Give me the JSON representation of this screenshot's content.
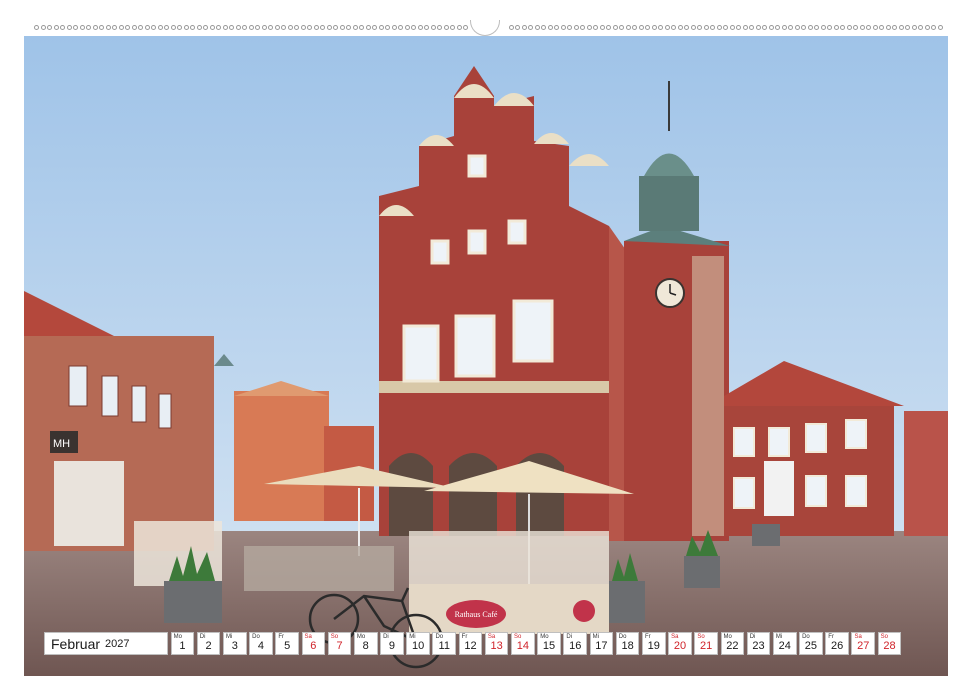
{
  "calendar": {
    "month": "Februar",
    "year": "2027",
    "days": [
      {
        "wd": "Mo",
        "num": "1",
        "red": false
      },
      {
        "wd": "Di",
        "num": "2",
        "red": false
      },
      {
        "wd": "Mi",
        "num": "3",
        "red": false
      },
      {
        "wd": "Do",
        "num": "4",
        "red": false
      },
      {
        "wd": "Fr",
        "num": "5",
        "red": false
      },
      {
        "wd": "Sa",
        "num": "6",
        "red": true
      },
      {
        "wd": "So",
        "num": "7",
        "red": true
      },
      {
        "wd": "Mo",
        "num": "8",
        "red": false
      },
      {
        "wd": "Di",
        "num": "9",
        "red": false
      },
      {
        "wd": "Mi",
        "num": "10",
        "red": false
      },
      {
        "wd": "Do",
        "num": "11",
        "red": false
      },
      {
        "wd": "Fr",
        "num": "12",
        "red": false
      },
      {
        "wd": "Sa",
        "num": "13",
        "red": true
      },
      {
        "wd": "So",
        "num": "14",
        "red": true
      },
      {
        "wd": "Mo",
        "num": "15",
        "red": false
      },
      {
        "wd": "Di",
        "num": "16",
        "red": false
      },
      {
        "wd": "Mi",
        "num": "17",
        "red": false
      },
      {
        "wd": "Do",
        "num": "18",
        "red": false
      },
      {
        "wd": "Fr",
        "num": "19",
        "red": false
      },
      {
        "wd": "Sa",
        "num": "20",
        "red": true
      },
      {
        "wd": "So",
        "num": "21",
        "red": true
      },
      {
        "wd": "Mo",
        "num": "22",
        "red": false
      },
      {
        "wd": "Di",
        "num": "23",
        "red": false
      },
      {
        "wd": "Mi",
        "num": "24",
        "red": false
      },
      {
        "wd": "Do",
        "num": "25",
        "red": false
      },
      {
        "wd": "Fr",
        "num": "26",
        "red": false
      },
      {
        "wd": "Sa",
        "num": "27",
        "red": true
      },
      {
        "wd": "So",
        "num": "28",
        "red": true
      }
    ]
  },
  "photo": {
    "shop_sign": "MH",
    "cafe_sign": "Rathaus Café"
  },
  "colors": {
    "sky": "#c9def2",
    "brick": "#a8423a",
    "pavement": "#8a6f6a",
    "weekend_red": "#d0232a"
  }
}
